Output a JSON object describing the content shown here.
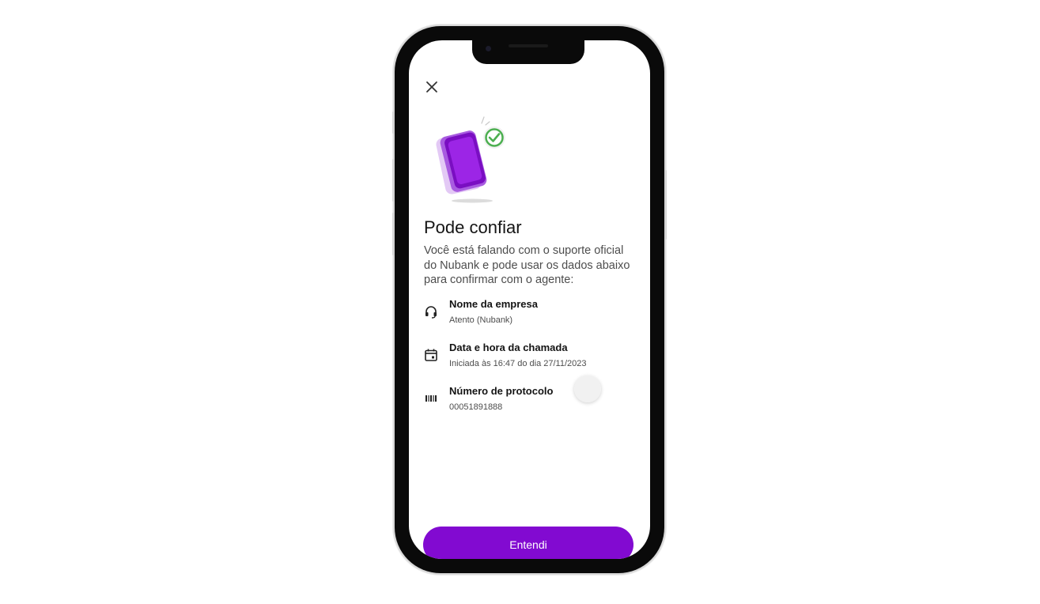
{
  "colors": {
    "accent": "#820ad1",
    "success": "#4caf50"
  },
  "icons": {
    "close": "close-icon",
    "company": "headset-icon",
    "datetime": "calendar-icon",
    "protocol": "barcode-icon",
    "illustration": "phone-verified-illustration"
  },
  "content": {
    "title": "Pode confiar",
    "description": "Você está falando com o suporte oficial do Nubank e pode usar os dados abaixo para confirmar com o agente:",
    "items": [
      {
        "title": "Nome da empresa",
        "value": "Atento (Nubank)"
      },
      {
        "title": "Data e hora da chamada",
        "value": "Iniciada às 16:47 do dia  27/11/2023"
      },
      {
        "title": "Número de protocolo",
        "value": "00051891888"
      }
    ]
  },
  "footer": {
    "button_label": "Entendi"
  }
}
